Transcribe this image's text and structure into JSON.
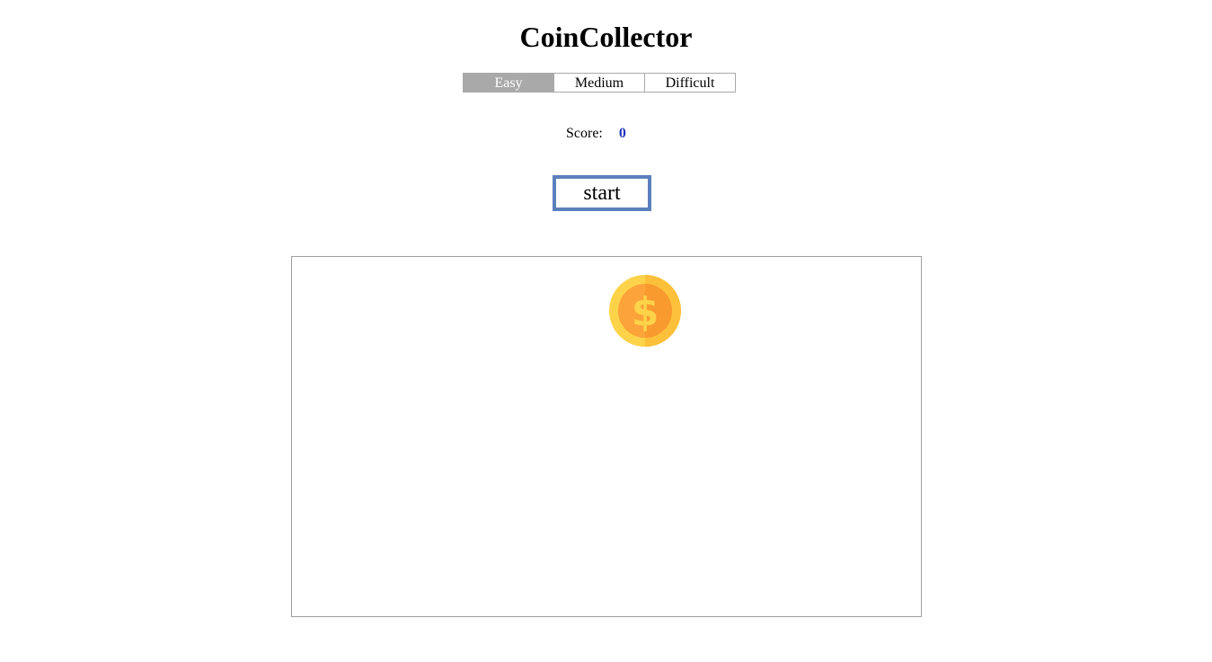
{
  "title": "CoinCollector",
  "levels": [
    "Easy",
    "Medium",
    "Difficult"
  ],
  "selected_level": "Easy",
  "score": {
    "label": "Score:",
    "value": "0"
  },
  "start_label": "start",
  "coin": {
    "icon": "dollar-coin-icon",
    "symbol": "$"
  },
  "colors": {
    "level_active_bg": "#a9a9a9",
    "score_value": "#2233bb",
    "start_border": "#5b7fbd",
    "coin_outer": "#fdd34a",
    "coin_inner": "#fca33a"
  }
}
